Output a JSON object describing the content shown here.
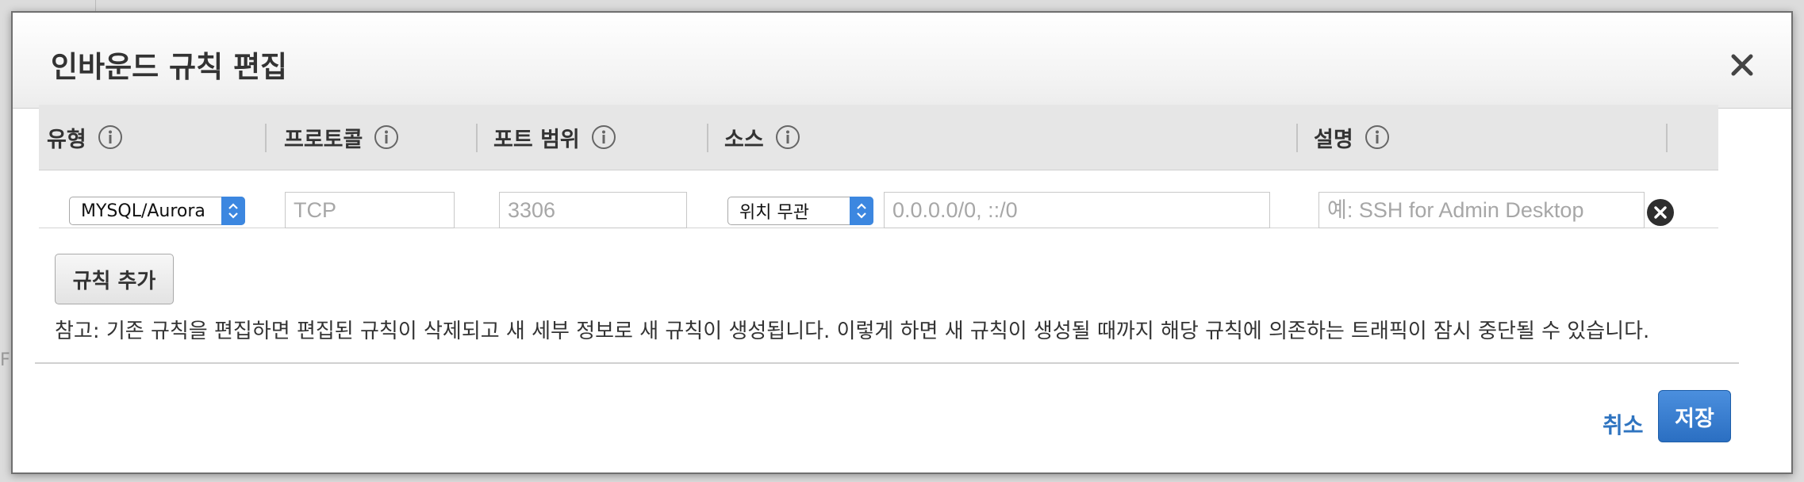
{
  "backdrop": {
    "glyph": "F"
  },
  "dialog": {
    "title": "인바운드 규칙 편집",
    "close_icon": "close-icon"
  },
  "table": {
    "headers": [
      "유형",
      "프로토콜",
      "포트 범위",
      "소스",
      "설명"
    ],
    "info_icon": "info-icon",
    "rows": [
      {
        "type": "MYSQL/Aurora",
        "protocol": "TCP",
        "port_range": "3306",
        "source_type": "위치 무관",
        "source_cidr": "0.0.0.0/0, ::/0",
        "description": "",
        "description_placeholder": "예: SSH for Admin Desktop",
        "remove_icon": "remove-circle-icon"
      }
    ]
  },
  "add_rule_label": "규칙 추가",
  "note": "참고: 기존 규칙을 편집하면 편집된 규칙이 삭제되고 새 세부 정보로 새 규칙이 생성됩니다. 이렇게 하면 새 규칙이 생성될 때까지 해당 규칙에 의존하는 트래픽이 잠시 중단될 수 있습니다.",
  "footer": {
    "cancel_label": "취소",
    "save_label": "저장"
  },
  "colors": {
    "primary": "#3c87e0",
    "link": "#2f74c0",
    "header_bg": "#e6e6e6"
  }
}
